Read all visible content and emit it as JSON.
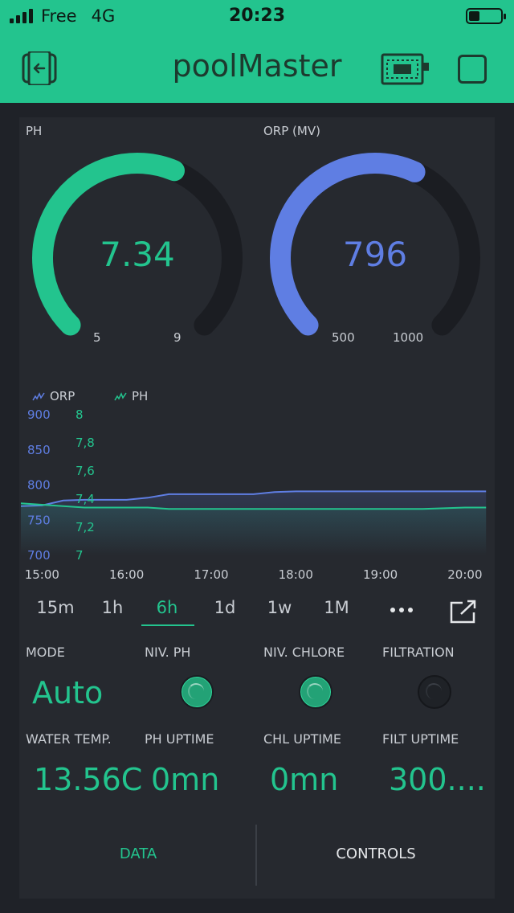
{
  "status_bar": {
    "carrier": "Free",
    "network": "4G",
    "time": "20:23",
    "battery_level": 0.35
  },
  "app": {
    "title": "poolMaster",
    "accent_color": "#23c48e"
  },
  "gauges": [
    {
      "label": "PH",
      "value": "7.34",
      "min": "5",
      "max": "9",
      "fraction": 0.585,
      "color": "#23c48e"
    },
    {
      "label": "ORP (MV)",
      "value": "796",
      "min": "500",
      "max": "1000",
      "fraction": 0.592,
      "color": "#5f7ee3"
    }
  ],
  "chart_data": {
    "type": "line",
    "series": [
      {
        "name": "ORP",
        "color": "#5f7ee3",
        "axis": "left",
        "x": [
          "14:45",
          "15:00",
          "15:15",
          "15:30",
          "15:45",
          "16:00",
          "16:15",
          "16:30",
          "16:45",
          "17:00",
          "17:15",
          "17:30",
          "17:45",
          "18:00",
          "18:30",
          "19:00",
          "19:30",
          "20:00",
          "20:15"
        ],
        "values": [
          770,
          771,
          778,
          779,
          779,
          779,
          782,
          787,
          787,
          787,
          787,
          787,
          790,
          791,
          791,
          791,
          791,
          791,
          791
        ]
      },
      {
        "name": "PH",
        "color": "#23c48e",
        "axis": "right",
        "x": [
          "14:45",
          "15:00",
          "15:15",
          "15:30",
          "15:45",
          "16:00",
          "16:15",
          "16:30",
          "16:45",
          "17:00",
          "17:15",
          "17:30",
          "17:45",
          "18:00",
          "18:30",
          "19:00",
          "19:30",
          "20:00",
          "20:15"
        ],
        "values": [
          7.37,
          7.36,
          7.35,
          7.34,
          7.34,
          7.34,
          7.34,
          7.33,
          7.33,
          7.33,
          7.33,
          7.33,
          7.33,
          7.33,
          7.33,
          7.33,
          7.33,
          7.34,
          7.34
        ]
      }
    ],
    "left_axis": {
      "ticks": [
        "900",
        "850",
        "800",
        "750",
        "700"
      ],
      "range": [
        700,
        900
      ]
    },
    "right_axis": {
      "ticks": [
        "8",
        "7,8",
        "7,6",
        "7,4",
        "7,2",
        "7"
      ],
      "range": [
        7,
        8
      ]
    },
    "x_ticks": [
      "15:00",
      "16:00",
      "17:00",
      "18:00",
      "19:00",
      "20:00"
    ],
    "x_range": [
      "14:45",
      "20:20"
    ],
    "legend_placement": "top-left",
    "grid": false
  },
  "time_ranges": {
    "items": [
      "15m",
      "1h",
      "6h",
      "1d",
      "1w",
      "1M"
    ],
    "active": "6h"
  },
  "widgets": {
    "mode": {
      "label": "MODE",
      "value": "Auto"
    },
    "niv_ph": {
      "label": "NIV. PH",
      "state": "on"
    },
    "niv_chlore": {
      "label": "NIV. CHLORE",
      "state": "on"
    },
    "filtration": {
      "label": "FILTRATION",
      "state": "off"
    },
    "water_temp": {
      "label": "WATER TEMP.",
      "value": "13.56C"
    },
    "ph_uptime": {
      "label": "PH UPTIME",
      "value": "0mn"
    },
    "chl_uptime": {
      "label": "CHL UPTIME",
      "value": "0mn"
    },
    "filt_uptime": {
      "label": "FILT UPTIME",
      "value": "300...."
    }
  },
  "bottom_tabs": {
    "items": [
      "DATA",
      "CONTROLS"
    ],
    "active": "DATA"
  }
}
